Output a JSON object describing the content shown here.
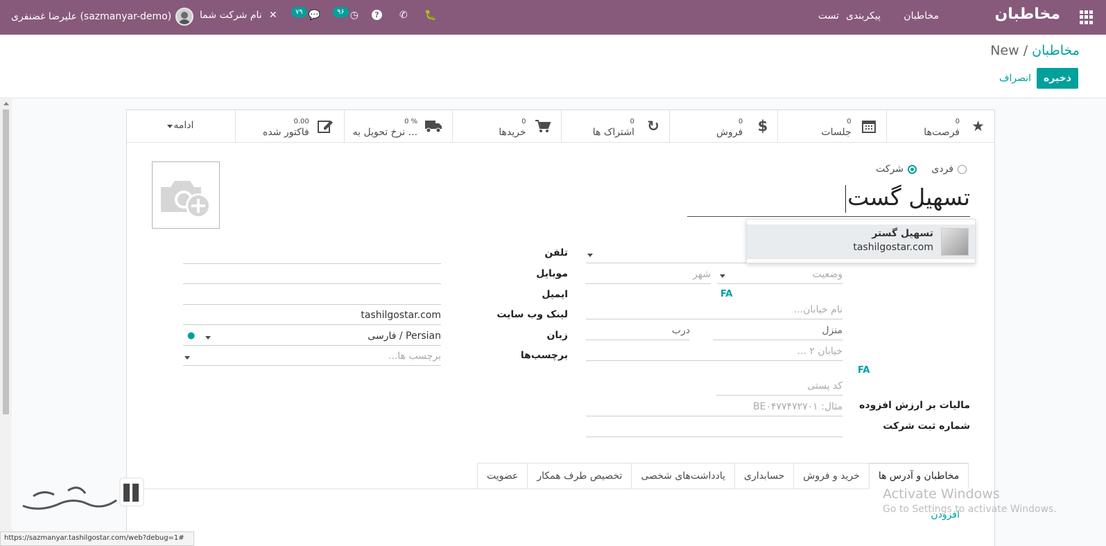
{
  "nav": {
    "brand": "مخاطبان",
    "menu": [
      "مخاطبان",
      "پیکربندی",
      "تست"
    ],
    "user_name": "علیرضا غضنفری (sazmanyar-demo)",
    "company": "نام شرکت شما",
    "messages_count": "۷۹",
    "activities_count": "۹۶"
  },
  "breadcrumb": {
    "parent": "مخاطبان",
    "current": "New"
  },
  "actions": {
    "save": "ذخیره",
    "discard": "انصراف"
  },
  "smart_buttons": [
    {
      "label": "فرصت‌ها",
      "icon": "star-icon"
    },
    {
      "label": "جلسات",
      "icon": "calendar-icon"
    },
    {
      "label": "فروش",
      "icon": "dollar-icon"
    },
    {
      "label": "اشتراک ها",
      "icon": "refresh-icon"
    },
    {
      "label": "خریدها",
      "icon": "cart-icon"
    },
    {
      "label": "نرخ تحویل به ...",
      "icon": "truck-icon",
      "prefix": "%"
    },
    {
      "label": "فاکتور شده",
      "icon": "edit-icon",
      "prefix": "0.00"
    }
  ],
  "more_label": "ادامه",
  "company_type": {
    "individual": "فردی",
    "company": "شرکت",
    "selected": "company"
  },
  "name_value": "تسهیل گست",
  "autocomplete": {
    "name": "تسهیل گستر",
    "domain": "tashilgostar.com"
  },
  "labels": {
    "phone": "تلفن",
    "mobile": "موبایل",
    "email": "ایمیل",
    "website": "لینک وب سایت",
    "language": "زبان",
    "tags": "برچسب‌ها",
    "vat": "مالیات بر ارزش افزوده",
    "company_reg": "شماره ثبت شرکت"
  },
  "fields": {
    "website": "tashilgostar.com",
    "language": "Persian / فارسی",
    "tags_placeholder": "برچسب ها...",
    "city_placeholder": "شهر",
    "state_placeholder": "وضعیت",
    "street_placeholder": "نام خیابان...",
    "building_placeholder": "منزل",
    "door_placeholder": "درب",
    "street2_placeholder": "خیابان ۲ ...",
    "zip_placeholder": "کد پستی",
    "vat_placeholder": "مثال: BE۰۴۷۷۴۷۲۷۰۱",
    "fa": "FA"
  },
  "tabs": [
    "مخاطبان و آدرس ها",
    "خرید و فروش",
    "حسابداری",
    "یادداشت‌های شخصی",
    "تخصیص طرف همکار",
    "عضویت"
  ],
  "add_link": "افزودن",
  "watermark": {
    "line1": "Activate Windows",
    "line2": "Go to Settings to activate Windows."
  },
  "status_url": "https://sazmanyar.tashilgostar.com/web?debug=1#"
}
